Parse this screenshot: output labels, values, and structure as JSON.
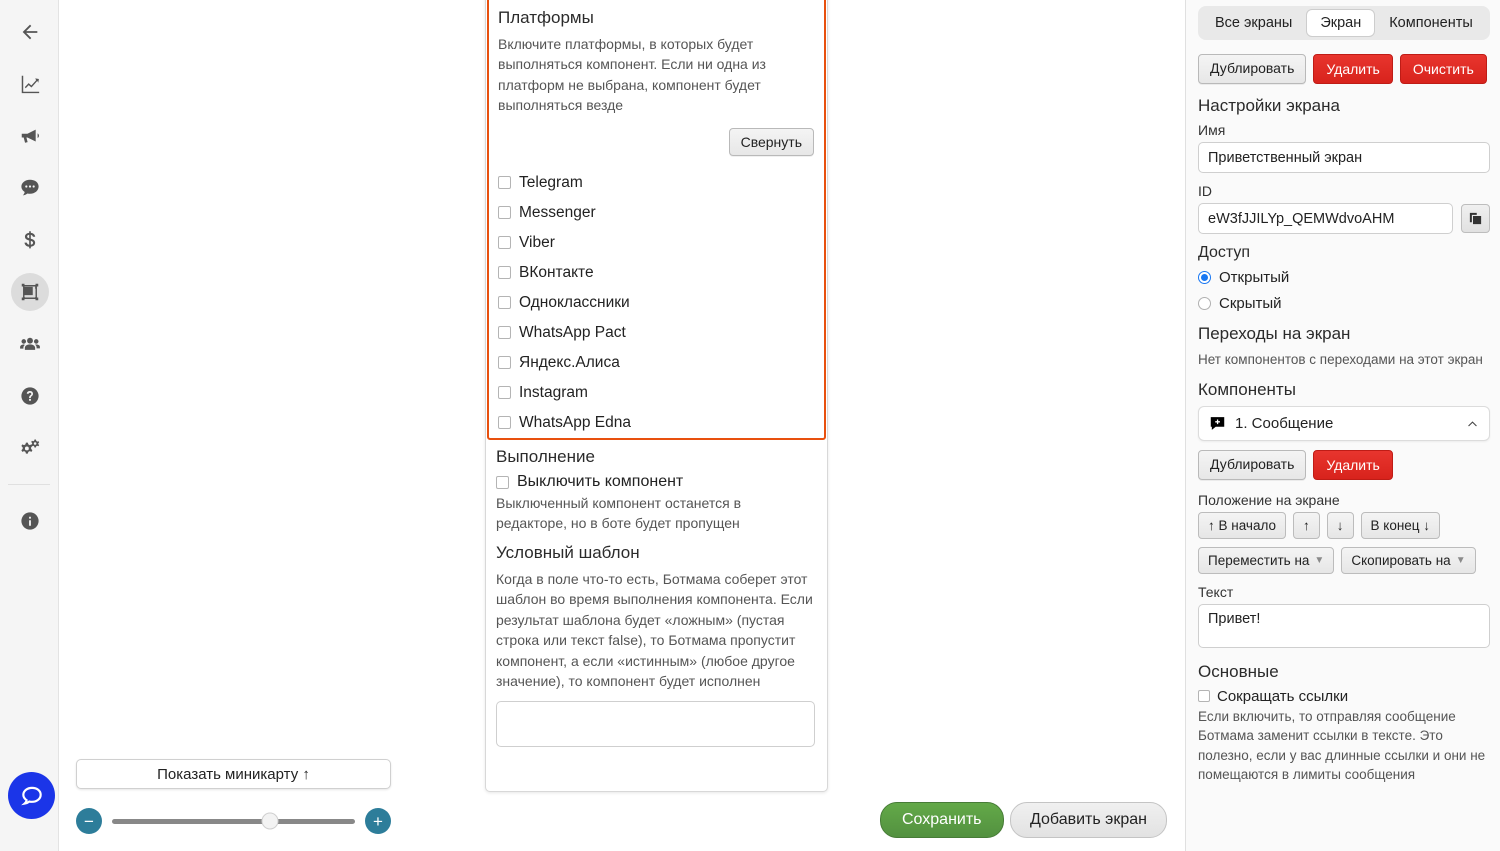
{
  "sidebar": {
    "items": [
      {
        "name": "back-arrow",
        "icon": "back-arrow-icon",
        "active": false
      },
      {
        "name": "analytics",
        "icon": "chart-trend-icon",
        "active": false
      },
      {
        "name": "broadcast",
        "icon": "megaphone-icon",
        "active": false
      },
      {
        "name": "chats",
        "icon": "speech-bubble-icon",
        "active": false
      },
      {
        "name": "billing",
        "icon": "dollar-icon",
        "active": false
      },
      {
        "name": "editor",
        "icon": "canvas-frame-icon",
        "active": true
      },
      {
        "name": "team",
        "icon": "users-icon",
        "active": false
      },
      {
        "name": "help",
        "icon": "question-circle-icon",
        "active": false
      },
      {
        "name": "settings",
        "icon": "gears-icon",
        "active": false
      },
      {
        "name": "info",
        "icon": "info-circle-icon",
        "active": false
      }
    ],
    "fab_icon": "chat-bubble-icon"
  },
  "canvas": {
    "minimap_button": "Показать миникарту ↑",
    "zoom_out": "−",
    "zoom_in": "+",
    "zoom_position_percent": 65
  },
  "component_card": {
    "platforms": {
      "title": "Платформы",
      "description": "Включите платформы, в которых будет выполняться компонент. Если ни одна из платформ не выбрана, компонент будет выполняться везде",
      "collapse_button": "Свернуть",
      "border_color": "#e8500e",
      "options": [
        {
          "label": "Telegram",
          "checked": false
        },
        {
          "label": "Messenger",
          "checked": false
        },
        {
          "label": "Viber",
          "checked": false
        },
        {
          "label": "ВКонтакте",
          "checked": false
        },
        {
          "label": "Одноклассники",
          "checked": false
        },
        {
          "label": "WhatsApp Pact",
          "checked": false
        },
        {
          "label": "Яндекс.Алиса",
          "checked": false
        },
        {
          "label": "Instagram",
          "checked": false
        },
        {
          "label": "WhatsApp Edna",
          "checked": false
        }
      ]
    },
    "execution": {
      "title": "Выполнение",
      "disable_checkbox_label": "Выключить компонент",
      "disable_checked": false,
      "disable_description": "Выключенный компонент останется в редакторе, но в боте будет пропущен",
      "condition_title": "Условный шаблон",
      "condition_description": "Когда в поле что-то есть, Ботмама соберет этот шаблон во время выполнения компонента. Если результат шаблона будет «ложным» (пустая строка или текст false), то Ботмама пропустит компонент, а если «истинным» (любое другое значение), то компонент будет исполнен",
      "condition_value": "",
      "condition_placeholder": ""
    }
  },
  "footer": {
    "save_label": "Сохранить",
    "add_screen_label": "Добавить экран",
    "save_color": "#589443"
  },
  "right_panel": {
    "tabs": [
      {
        "label": "Все экраны",
        "active": false
      },
      {
        "label": "Экран",
        "active": true
      },
      {
        "label": "Компоненты",
        "active": false
      }
    ],
    "screen_actions": [
      {
        "label": "Дублировать",
        "style": "grey"
      },
      {
        "label": "Удалить",
        "style": "red"
      },
      {
        "label": "Очистить",
        "style": "red"
      }
    ],
    "screen_settings_title": "Настройки экрана",
    "name_label": "Имя",
    "name_value": "Приветственный экран",
    "id_label": "ID",
    "id_value": "eW3fJJILYp_QEMWdvoAHM",
    "copy_icon": "copy-icon",
    "access_label": "Доступ",
    "access_options": [
      {
        "label": "Открытый",
        "selected": true
      },
      {
        "label": "Скрытый",
        "selected": false
      }
    ],
    "transitions_title": "Переходы на экран",
    "transitions_empty": "Нет компонентов с переходами на этот экран",
    "components_title": "Компоненты",
    "component_item": {
      "icon": "message-bubble-icon",
      "label": "1. Сообщение",
      "chevron": "chevron-up-icon"
    },
    "component_actions": [
      {
        "label": "Дублировать",
        "style": "grey"
      },
      {
        "label": "Удалить",
        "style": "red"
      }
    ],
    "position_title": "Положение на экране",
    "position_buttons": [
      {
        "label": "↑ В начало"
      },
      {
        "label": "↑"
      },
      {
        "label": "↓"
      },
      {
        "label": "В конец ↓"
      }
    ],
    "move_buttons": [
      {
        "label": "Переместить на",
        "caret": "▼"
      },
      {
        "label": "Скопировать на",
        "caret": "▼"
      }
    ],
    "text_label": "Текст",
    "text_value": "Привет!",
    "basics_title": "Основные",
    "shorten_links_label": "Сокращать ссылки",
    "shorten_links_checked": false,
    "shorten_links_description": "Если включить, то отправляя сообщение Ботмама заменит ссылки в тексте. Это полезно, если у вас длинные ссылки и они не помещаются в лимиты сообщения"
  }
}
